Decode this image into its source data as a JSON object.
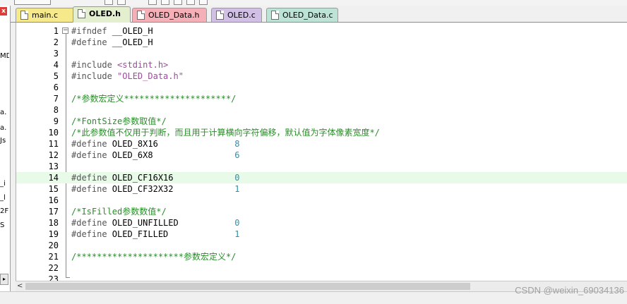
{
  "tabs": [
    {
      "label": "main.c",
      "color": "#f5e98c",
      "active": false
    },
    {
      "label": "OLED.h",
      "color": "#e4efcf",
      "active": true
    },
    {
      "label": "OLED_Data.h",
      "color": "#f4b0b6",
      "active": false
    },
    {
      "label": "OLED.c",
      "color": "#d2bfe6",
      "active": false
    },
    {
      "label": "OLED_Data.c",
      "color": "#bde3d7",
      "active": false
    }
  ],
  "left_panel": {
    "close_glyph": "x",
    "fragments": [
      "MD",
      "a.",
      "a.",
      "Js",
      "_i",
      "_l",
      "2F",
      "S"
    ]
  },
  "code_lines": [
    {
      "n": "1",
      "segs": [
        {
          "t": "#ifndef ",
          "c": "c-pre"
        },
        {
          "t": "__OLED_H",
          "c": "c-id"
        }
      ]
    },
    {
      "n": "2",
      "segs": [
        {
          "t": "#define ",
          "c": "c-pre"
        },
        {
          "t": "__OLED_H",
          "c": "c-id"
        }
      ]
    },
    {
      "n": "3",
      "segs": []
    },
    {
      "n": "4",
      "segs": [
        {
          "t": "#include ",
          "c": "c-pre"
        },
        {
          "t": "<stdint.h>",
          "c": "c-str"
        }
      ]
    },
    {
      "n": "5",
      "segs": [
        {
          "t": "#include ",
          "c": "c-pre"
        },
        {
          "t": "\"OLED_Data.h\"",
          "c": "c-str"
        }
      ]
    },
    {
      "n": "6",
      "segs": []
    },
    {
      "n": "7",
      "segs": [
        {
          "t": "/*参数宏定义*********************/",
          "c": "c-com"
        }
      ]
    },
    {
      "n": "8",
      "segs": []
    },
    {
      "n": "9",
      "segs": [
        {
          "t": "/*FontSize参数取值*/",
          "c": "c-com"
        }
      ]
    },
    {
      "n": "10",
      "segs": [
        {
          "t": "/*此参数值不仅用于判断，而且用于计算横向字符偏移，默认值为字体像素宽度*/",
          "c": "c-com"
        }
      ]
    },
    {
      "n": "11",
      "segs": [
        {
          "t": "#define ",
          "c": "c-pre"
        },
        {
          "t": "OLED_8X16               ",
          "c": "c-id"
        },
        {
          "t": "8",
          "c": "c-num"
        }
      ]
    },
    {
      "n": "12",
      "segs": [
        {
          "t": "#define ",
          "c": "c-pre"
        },
        {
          "t": "OLED_6X8                ",
          "c": "c-id"
        },
        {
          "t": "6",
          "c": "c-num"
        }
      ]
    },
    {
      "n": "13",
      "segs": []
    },
    {
      "n": "14",
      "segs": [
        {
          "t": "#define ",
          "c": "c-pre"
        },
        {
          "t": "OLED_CF16X16            ",
          "c": "c-id"
        },
        {
          "t": "0",
          "c": "c-num"
        }
      ],
      "hl": true
    },
    {
      "n": "15",
      "segs": [
        {
          "t": "#define ",
          "c": "c-pre"
        },
        {
          "t": "OLED_CF32X32            ",
          "c": "c-id"
        },
        {
          "t": "1",
          "c": "c-num"
        }
      ]
    },
    {
      "n": "16",
      "segs": []
    },
    {
      "n": "17",
      "segs": [
        {
          "t": "/*IsFilled参数数值*/",
          "c": "c-com"
        }
      ]
    },
    {
      "n": "18",
      "segs": [
        {
          "t": "#define ",
          "c": "c-pre"
        },
        {
          "t": "OLED_UNFILLED           ",
          "c": "c-id"
        },
        {
          "t": "0",
          "c": "c-num"
        }
      ]
    },
    {
      "n": "19",
      "segs": [
        {
          "t": "#define ",
          "c": "c-pre"
        },
        {
          "t": "OLED_FILLED             ",
          "c": "c-id"
        },
        {
          "t": "1",
          "c": "c-num"
        }
      ]
    },
    {
      "n": "20",
      "segs": []
    },
    {
      "n": "21",
      "segs": [
        {
          "t": "/*********************参数宏定义*/",
          "c": "c-com"
        }
      ]
    },
    {
      "n": "22",
      "segs": []
    },
    {
      "n": "23",
      "segs": []
    }
  ],
  "scrollbar": {
    "left_arrow": "<"
  },
  "watermark": "CSDN @weixin_69034136",
  "colors": {
    "line_highlight": "#e8fae8",
    "comment": "#2a8c2a",
    "number": "#2b91af",
    "string": "#9c4a9c"
  }
}
